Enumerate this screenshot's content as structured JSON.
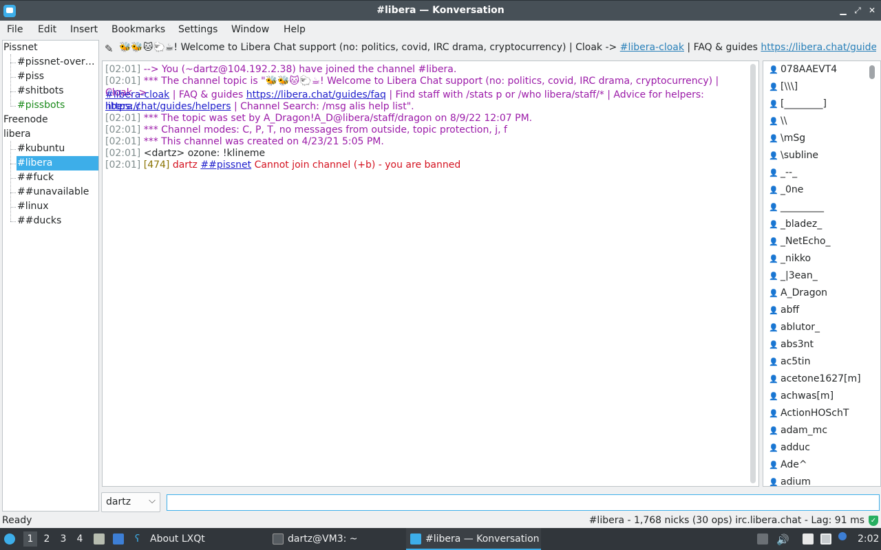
{
  "window": {
    "title": "#libera — Konversation"
  },
  "menu": [
    "File",
    "Edit",
    "Insert",
    "Bookmarks",
    "Settings",
    "Window",
    "Help"
  ],
  "tree": {
    "servers": [
      {
        "name": "Pissnet",
        "channels": [
          "#pissnet-over…",
          "#piss",
          "#shitbots",
          "#pissbots"
        ]
      },
      {
        "name": "Freenode",
        "channels": []
      },
      {
        "name": "libera",
        "channels": [
          "#kubuntu",
          "#libera",
          "##fuck",
          "##unavailable",
          "#linux",
          "##ducks"
        ]
      }
    ]
  },
  "topic": {
    "prefix": "🐝🐝🐱🐑☕! Welcome to Libera Chat support (no: politics, covid, IRC drama, cryptocurrency) | Cloak -> ",
    "link1": "#libera-cloak",
    "mid": " | FAQ & guides ",
    "link2": "https://libera.chat/guides/fa..."
  },
  "chat": {
    "l1_ts": "[02:01]",
    "l1": "--> You (~dartz@104.192.2.38) have joined the channel #libera.",
    "l2_ts": "[02:01]",
    "l2": "*** The channel topic is \"🐝🐝🐱🐑☕! Welcome to Libera Chat support (no: politics, covid, IRC drama, cryptocurrency) | Cloak ->",
    "l3_link": "#libera-cloak",
    "l3_a": " | FAQ & guides ",
    "l3_link2": "https://libera.chat/guides/faq",
    "l3_b": " | Find staff with /stats p or /who libera/staff/* | Advice for helpers: ",
    "l3_link3": "https://",
    "l4_link": "libera.chat/guides/helpers",
    "l4_a": " | Channel Search: /msg alis help list\".",
    "l5_ts": "[02:01]",
    "l5": "*** The topic was set by A_Dragon!A_D@libera/staff/dragon on 8/9/22 12:07 PM.",
    "l6_ts": "[02:01]",
    "l6": "*** Channel modes: C, P, T, no messages from outside, topic protection, j, f",
    "l7_ts": "[02:01]",
    "l7": "*** This channel was created on 4/23/21 5:05 PM.",
    "l8_ts": "[02:01]",
    "l8": "<dartz> ozone: !klineme",
    "l9_ts": "[02:01]",
    "l9_code": "[474]",
    "l9_nick": "dartz",
    "l9_chan": "##pissnet",
    "l9_msg": "Cannot join channel (+b) - you are banned"
  },
  "nicks": [
    "078AAEVT4",
    "[\\\\\\]",
    "[________]",
    "\\\\",
    "\\mSg",
    "\\subline",
    "_--_",
    "_0ne",
    "_________",
    "_bladez_",
    "_NetEcho_",
    "_nikko",
    "_|3ean_",
    "A_Dragon",
    "abff",
    "ablutor_",
    "abs3nt",
    "ac5tin",
    "acetone1627[m]",
    "achwas[m]",
    "ActionHOSchT",
    "adam_mc",
    "adduc",
    "Ade^",
    "adium"
  ],
  "input": {
    "nick": "dartz",
    "value": ""
  },
  "status": {
    "left": "Ready",
    "right": "#libera - 1,768 nicks (30 ops)  irc.libera.chat - Lag: 91 ms"
  },
  "taskbar": {
    "workspaces": [
      "1",
      "2",
      "3",
      "4"
    ],
    "about": "About LXQt",
    "terminal": "dartz@VM3: ~",
    "konversation": "#libera — Konversation",
    "clock": "2:02"
  },
  "colors": {
    "accent": "#3daee9",
    "titlebar": "#475057",
    "taskbar": "#31363b"
  }
}
